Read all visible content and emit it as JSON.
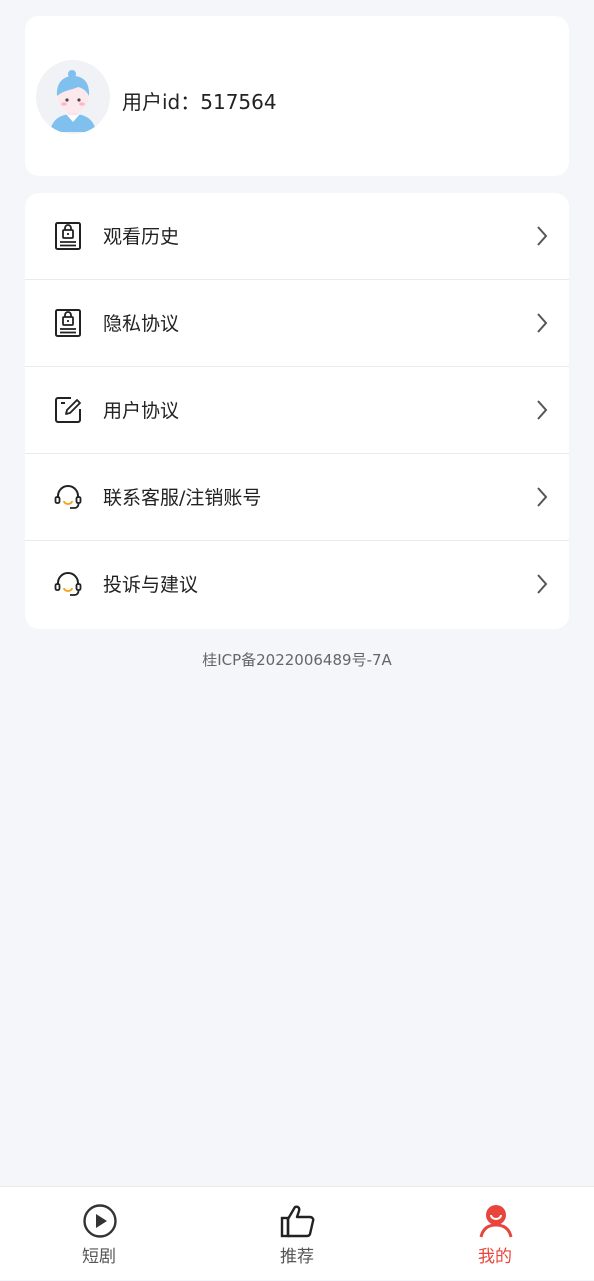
{
  "profile": {
    "user_id_text": "用户id：517564"
  },
  "menu": {
    "items": [
      {
        "label": "观看历史",
        "icon": "lock-document-icon"
      },
      {
        "label": "隐私协议",
        "icon": "lock-document-icon"
      },
      {
        "label": "用户协议",
        "icon": "edit-document-icon"
      },
      {
        "label": "联系客服/注销账号",
        "icon": "headset-icon"
      },
      {
        "label": "投诉与建议",
        "icon": "headset-icon"
      }
    ]
  },
  "footer": {
    "icp": "桂ICP备2022006489号-7A"
  },
  "bottom_nav": {
    "tabs": [
      {
        "label": "短剧",
        "icon": "play-circle-icon",
        "active": false
      },
      {
        "label": "推荐",
        "icon": "thumbs-up-icon",
        "active": false
      },
      {
        "label": "我的",
        "icon": "profile-icon",
        "active": true
      }
    ]
  },
  "colors": {
    "accent": "#e8463c",
    "background": "#f5f6fa",
    "card": "#ffffff"
  }
}
